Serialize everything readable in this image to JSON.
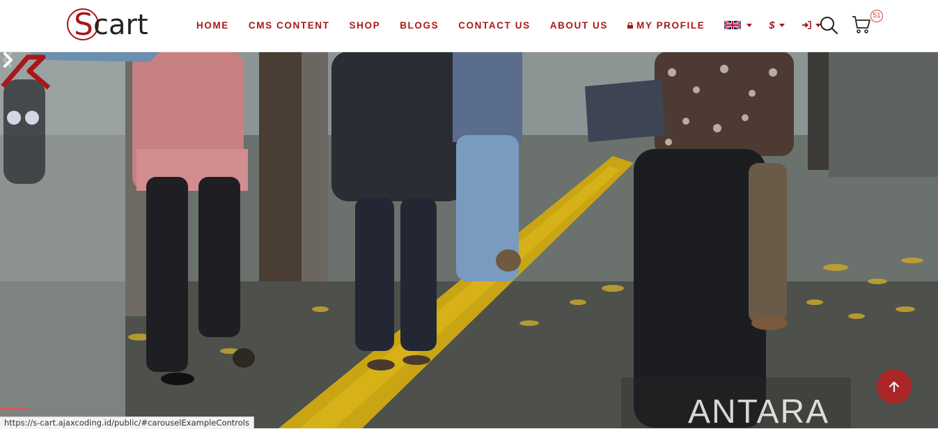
{
  "brand": {
    "logo_first": "S",
    "logo_rest": "cart"
  },
  "nav": {
    "items": [
      "HOME",
      "CMS CONTENT",
      "SHOP",
      "BLOGS",
      "CONTACT US",
      "ABOUT US"
    ],
    "profile_label": "MY PROFILE",
    "currency_symbol": "$"
  },
  "cart": {
    "count": "51"
  },
  "hero": {
    "watermark": "ANTARA"
  },
  "status_bar": {
    "url": "https://s-cart.ajaxcoding.id/public/#carouselExampleControls"
  },
  "icons": {
    "search": "search-icon",
    "cart": "cart-icon",
    "language": "uk-flag-icon",
    "account": "sign-in-icon",
    "lock": "lock-icon",
    "next": "chevron-right-icon",
    "scroll_top": "arrow-up-icon"
  },
  "colors": {
    "accent": "#a81818",
    "scroll_button": "#b32424"
  }
}
